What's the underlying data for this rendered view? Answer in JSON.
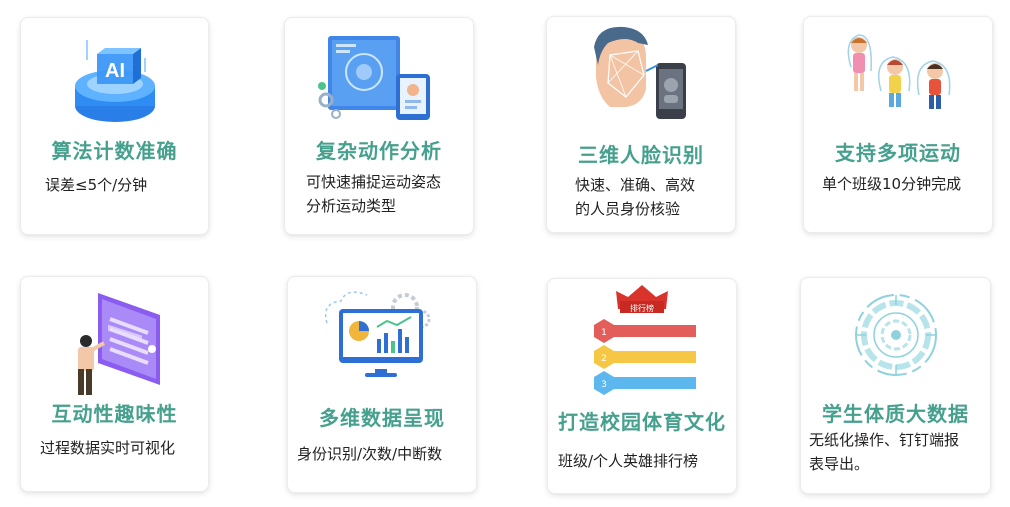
{
  "colors": {
    "title": "#46a08e",
    "text": "#222222",
    "card_bg": "#ffffff"
  },
  "features": [
    {
      "icon": "ai-chip-icon",
      "title": "算法计数准确",
      "desc": [
        "误差≤5个/分钟"
      ]
    },
    {
      "icon": "motion-analysis-icon",
      "title": "复杂动作分析",
      "desc": [
        "可快速捕捉运动姿态",
        "分析运动类型"
      ]
    },
    {
      "icon": "face-recognition-icon",
      "title": "三维人脸识别",
      "desc": [
        "快速、准确、高效",
        "的人员身份核验"
      ]
    },
    {
      "icon": "jump-rope-kids-icon",
      "title": "支持多项运动",
      "desc": [
        "单个班级10分钟完成"
      ]
    },
    {
      "icon": "interactive-screen-icon",
      "title": "互动性趣味性",
      "desc": [
        "过程数据实时可视化"
      ]
    },
    {
      "icon": "data-dashboard-icon",
      "title": "多维数据呈现",
      "desc": [
        "身份识别/次数/中断数"
      ]
    },
    {
      "icon": "ranking-board-icon",
      "title": "打造校园体育文化",
      "desc": [
        "班级/个人英雄排行榜"
      ]
    },
    {
      "icon": "big-data-circle-icon",
      "title": "学生体质大数据",
      "desc": [
        "无纸化操作、钉钉端报",
        "表导出。"
      ]
    }
  ],
  "ranking_badge": "排行榜",
  "ranking_numbers": [
    "1",
    "2",
    "3"
  ],
  "ai_text": "AI"
}
